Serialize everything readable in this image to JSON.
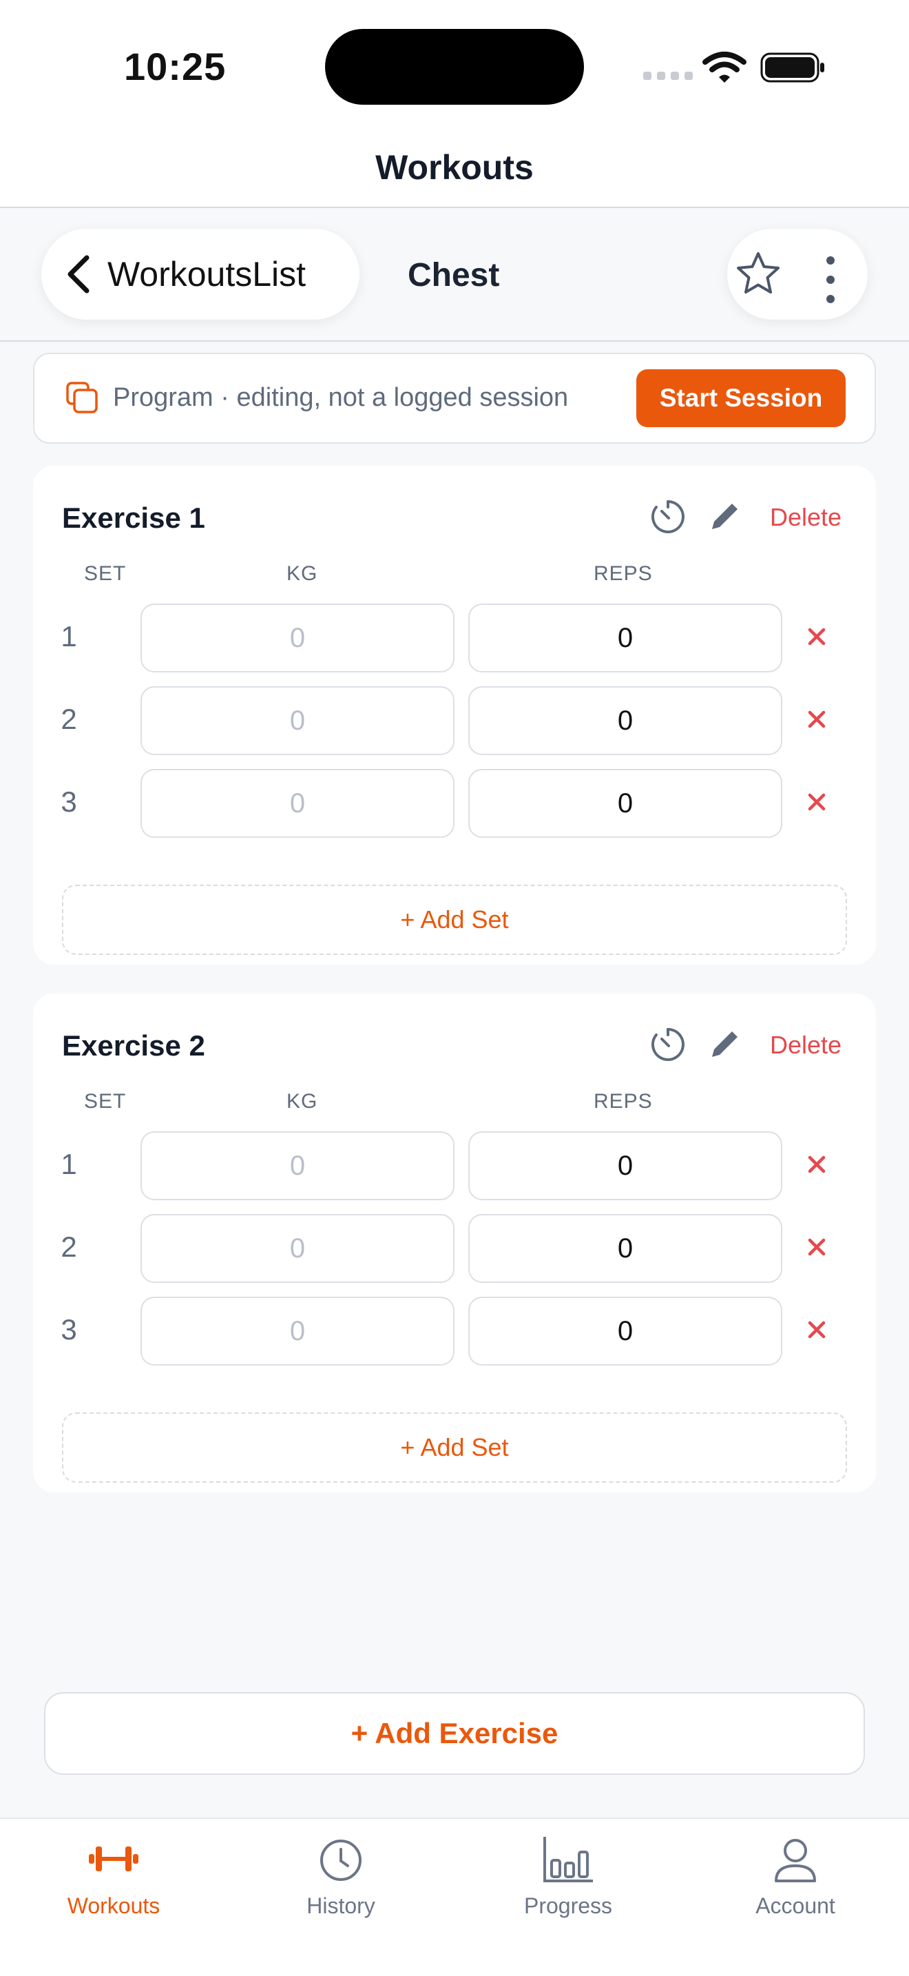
{
  "status_bar": {
    "time": "10:25"
  },
  "nav": {
    "title": "Workouts"
  },
  "subheader": {
    "back_label": "WorkoutsList",
    "title": "Chest"
  },
  "banner": {
    "text": "Program · editing, not a logged session",
    "start_label": "Start Session"
  },
  "columns": {
    "set": "SET",
    "kg": "KG",
    "reps": "REPS"
  },
  "delete_label": "Delete",
  "add_set_label": "+ Add Set",
  "exercises": [
    {
      "name": "Exercise 1",
      "sets": [
        {
          "set": "1",
          "kg": "0",
          "reps": "0"
        },
        {
          "set": "2",
          "kg": "0",
          "reps": "0"
        },
        {
          "set": "3",
          "kg": "0",
          "reps": "0"
        }
      ]
    },
    {
      "name": "Exercise 2",
      "sets": [
        {
          "set": "1",
          "kg": "0",
          "reps": "0"
        },
        {
          "set": "2",
          "kg": "0",
          "reps": "0"
        },
        {
          "set": "3",
          "kg": "0",
          "reps": "0"
        }
      ]
    }
  ],
  "add_exercise_label": "+ Add Exercise",
  "tabs": [
    {
      "label": "Workouts",
      "icon": "dumbbell-icon",
      "active": true
    },
    {
      "label": "History",
      "icon": "clock-icon",
      "active": false
    },
    {
      "label": "Progress",
      "icon": "bar-chart-icon",
      "active": false
    },
    {
      "label": "Account",
      "icon": "person-icon",
      "active": false
    }
  ],
  "colors": {
    "accent": "#ea580c",
    "danger": "#e5484d",
    "muted": "#5f6b7c"
  }
}
